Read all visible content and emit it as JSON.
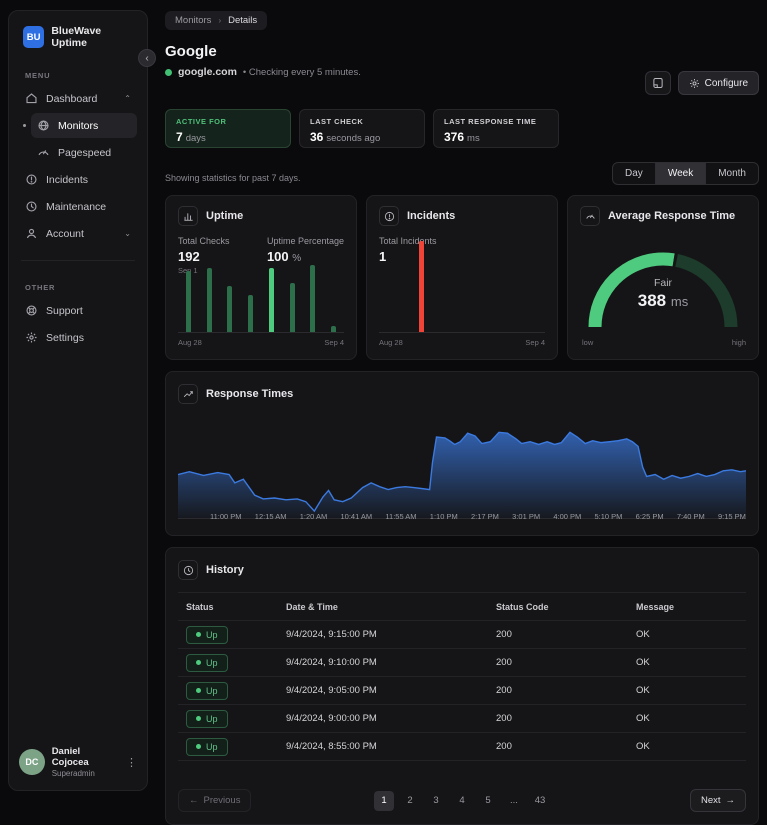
{
  "colors": {
    "accent_green": "#4ecb7e",
    "bar_green_dim": "#2d6e4b",
    "gauge_track": "#1d3c2b",
    "incident_red": "#f04438",
    "line_blue": "#3b7ae0",
    "logo_blue": "#2f6fe4"
  },
  "sidebar": {
    "logo_text": "BU",
    "app_name": "BlueWave Uptime",
    "menu_label": "MENU",
    "other_label": "OTHER",
    "items": [
      {
        "label": "Dashboard",
        "icon": "home-icon",
        "chevron": "up",
        "active": false,
        "sub": false
      },
      {
        "label": "Monitors",
        "icon": "globe-icon",
        "chevron": "",
        "active": true,
        "sub": true
      },
      {
        "label": "Pagespeed",
        "icon": "speedometer-icon",
        "chevron": "",
        "active": false,
        "sub": true
      },
      {
        "label": "Incidents",
        "icon": "alert-circle-icon",
        "chevron": "",
        "active": false,
        "sub": false
      },
      {
        "label": "Maintenance",
        "icon": "clock-icon",
        "chevron": "",
        "active": false,
        "sub": false
      },
      {
        "label": "Account",
        "icon": "user-icon",
        "chevron": "down",
        "active": false,
        "sub": false
      }
    ],
    "other_items": [
      {
        "label": "Support",
        "icon": "support-icon",
        "chevron": "",
        "active": false,
        "sub": false
      },
      {
        "label": "Settings",
        "icon": "gear-icon",
        "chevron": "",
        "active": false,
        "sub": false
      }
    ],
    "user": {
      "initials": "DC",
      "name": "Daniel Cojocea",
      "role": "Superadmin"
    }
  },
  "header": {
    "breadcrumbs": [
      "Monitors",
      "Details"
    ],
    "title": "Google",
    "host": "google.com",
    "check_note": "• Checking every 5 minutes.",
    "configure_label": "Configure"
  },
  "stats": [
    {
      "label": "ACTIVE FOR",
      "value": "7",
      "unit": "days",
      "highlight": true
    },
    {
      "label": "LAST CHECK",
      "value": "36",
      "unit": "seconds ago",
      "highlight": false
    },
    {
      "label": "LAST RESPONSE TIME",
      "value": "376",
      "unit": "ms",
      "highlight": false
    }
  ],
  "period": {
    "note": "Showing statistics for past 7 days.",
    "options": [
      "Day",
      "Week",
      "Month"
    ],
    "selected": "Week"
  },
  "chart_data": [
    {
      "type": "bar",
      "title": "Uptime",
      "total_checks_label": "Total Checks",
      "total_checks": "192",
      "date_note": "Sep 1",
      "uptime_pct_label": "Uptime Percentage",
      "uptime_pct": "100",
      "pct_unit": "%",
      "x_start": "Aug 28",
      "x_end": "Sep 4",
      "values": [
        0.82,
        0.86,
        0.62,
        0.5,
        0.86,
        0.66,
        0.9,
        0.08
      ],
      "highlight_index": 4
    },
    {
      "type": "bar",
      "title": "Incidents",
      "total_label": "Total Incidents",
      "total": "1",
      "x_start": "Aug 28",
      "x_end": "Sep 4",
      "bar_x_fraction": 0.24,
      "bar_height_fraction": 0.94
    },
    {
      "type": "gauge",
      "title": "Average Response Time",
      "status": "Fair",
      "value": "388",
      "unit": "ms",
      "low_label": "low",
      "high_label": "high",
      "fill_fraction": 0.55
    },
    {
      "type": "area",
      "title": "Response Times",
      "x_ticks": [
        "11:00 PM",
        "12:15 AM",
        "1:20 AM",
        "10:41 AM",
        "11:55 AM",
        "1:10 PM",
        "2:17 PM",
        "3:01 PM",
        "4:00 PM",
        "5:10 PM",
        "6:25 PM",
        "7:40 PM",
        "9:15 PM"
      ],
      "points": [
        [
          0,
          0.42
        ],
        [
          0.02,
          0.45
        ],
        [
          0.045,
          0.41
        ],
        [
          0.07,
          0.44
        ],
        [
          0.09,
          0.42
        ],
        [
          0.1,
          0.33
        ],
        [
          0.115,
          0.37
        ],
        [
          0.135,
          0.2
        ],
        [
          0.15,
          0.16
        ],
        [
          0.17,
          0.17
        ],
        [
          0.19,
          0.15
        ],
        [
          0.21,
          0.16
        ],
        [
          0.225,
          0.13
        ],
        [
          0.24,
          0.03
        ],
        [
          0.255,
          0.18
        ],
        [
          0.265,
          0.25
        ],
        [
          0.275,
          0.15
        ],
        [
          0.29,
          0.13
        ],
        [
          0.305,
          0.17
        ],
        [
          0.325,
          0.28
        ],
        [
          0.34,
          0.33
        ],
        [
          0.355,
          0.29
        ],
        [
          0.37,
          0.26
        ],
        [
          0.385,
          0.28
        ],
        [
          0.4,
          0.29
        ],
        [
          0.415,
          0.28
        ],
        [
          0.43,
          0.27
        ],
        [
          0.443,
          0.26
        ],
        [
          0.448,
          0.55
        ],
        [
          0.455,
          0.82
        ],
        [
          0.47,
          0.81
        ],
        [
          0.478,
          0.78
        ],
        [
          0.487,
          0.74
        ],
        [
          0.497,
          0.77
        ],
        [
          0.51,
          0.86
        ],
        [
          0.523,
          0.83
        ],
        [
          0.535,
          0.75
        ],
        [
          0.55,
          0.77
        ],
        [
          0.565,
          0.87
        ],
        [
          0.58,
          0.86
        ],
        [
          0.595,
          0.8
        ],
        [
          0.605,
          0.75
        ],
        [
          0.62,
          0.77
        ],
        [
          0.635,
          0.74
        ],
        [
          0.65,
          0.77
        ],
        [
          0.663,
          0.74
        ],
        [
          0.675,
          0.76
        ],
        [
          0.69,
          0.87
        ],
        [
          0.703,
          0.82
        ],
        [
          0.717,
          0.75
        ],
        [
          0.73,
          0.78
        ],
        [
          0.745,
          0.76
        ],
        [
          0.76,
          0.77
        ],
        [
          0.775,
          0.78
        ],
        [
          0.79,
          0.8
        ],
        [
          0.8,
          0.77
        ],
        [
          0.81,
          0.72
        ],
        [
          0.818,
          0.5
        ],
        [
          0.825,
          0.4
        ],
        [
          0.84,
          0.42
        ],
        [
          0.855,
          0.37
        ],
        [
          0.87,
          0.41
        ],
        [
          0.885,
          0.38
        ],
        [
          0.9,
          0.4
        ],
        [
          0.915,
          0.43
        ],
        [
          0.93,
          0.4
        ],
        [
          0.945,
          0.42
        ],
        [
          0.96,
          0.46
        ],
        [
          0.975,
          0.47
        ],
        [
          0.99,
          0.45
        ],
        [
          1,
          0.46
        ]
      ]
    }
  ],
  "history": {
    "title": "History",
    "columns": [
      "Status",
      "Date & Time",
      "Status Code",
      "Message"
    ],
    "rows": [
      {
        "status": "Up",
        "datetime": "9/4/2024, 9:15:00 PM",
        "code": "200",
        "message": "OK"
      },
      {
        "status": "Up",
        "datetime": "9/4/2024, 9:10:00 PM",
        "code": "200",
        "message": "OK"
      },
      {
        "status": "Up",
        "datetime": "9/4/2024, 9:05:00 PM",
        "code": "200",
        "message": "OK"
      },
      {
        "status": "Up",
        "datetime": "9/4/2024, 9:00:00 PM",
        "code": "200",
        "message": "OK"
      },
      {
        "status": "Up",
        "datetime": "9/4/2024, 8:55:00 PM",
        "code": "200",
        "message": "OK"
      }
    ]
  },
  "pagination": {
    "previous_label": "Previous",
    "pages": [
      "1",
      "2",
      "3",
      "4",
      "5",
      "...",
      "43"
    ],
    "active_page": "1",
    "next_label": "Next"
  }
}
